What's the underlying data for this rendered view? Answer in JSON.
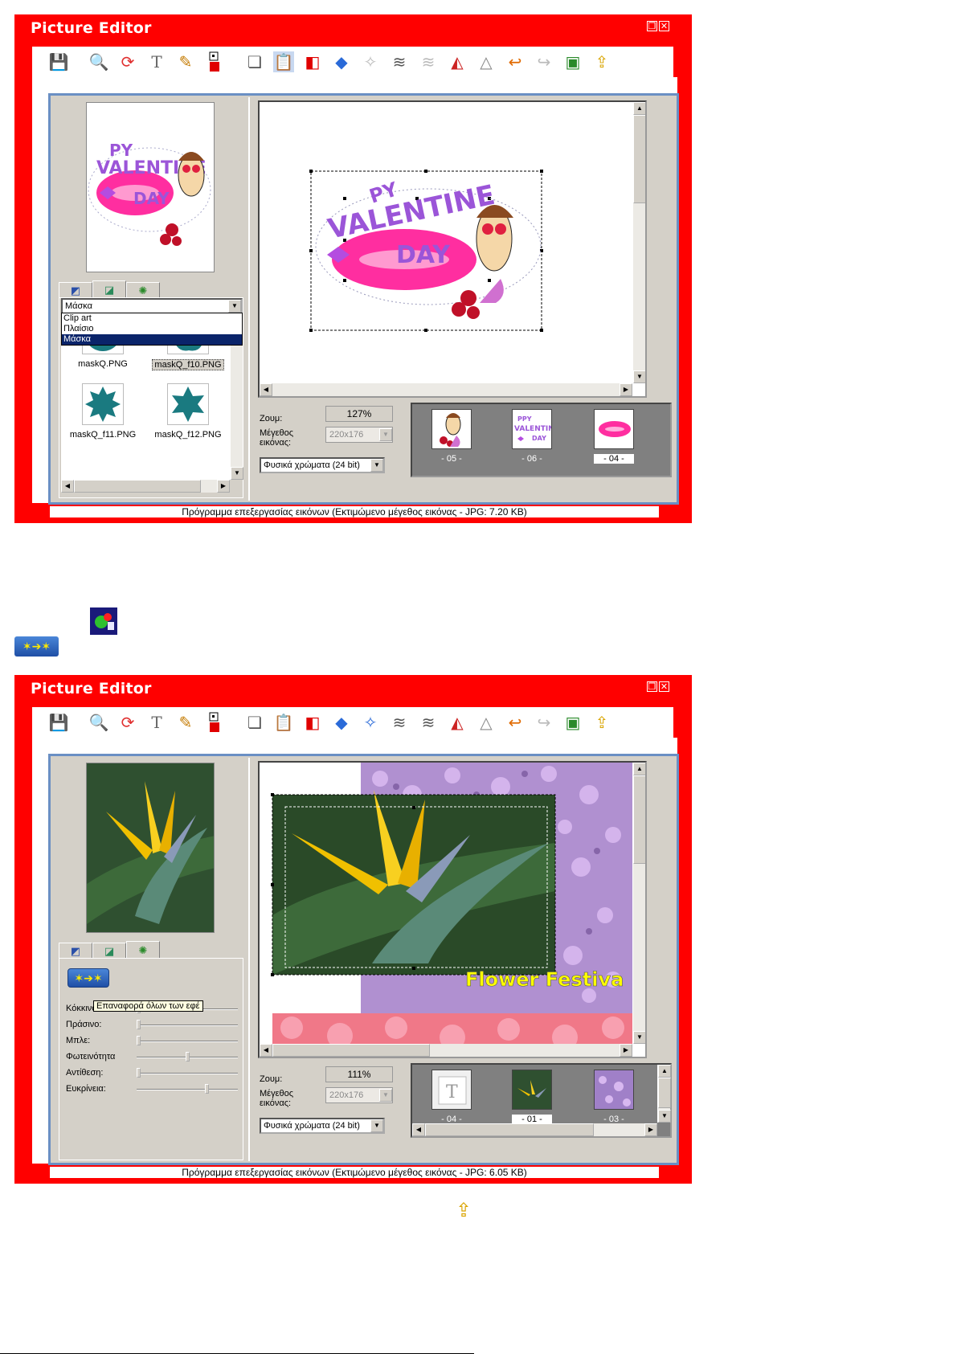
{
  "window1": {
    "title": "Picture Editor",
    "combo_value": "Μάσκα",
    "dropdown_options": [
      "Clip art",
      "Πλαίσιο",
      "Μάσκα"
    ],
    "masks": [
      "maskQ.PNG",
      "maskQ_f10.PNG",
      "maskQ_f11.PNG",
      "maskQ_f12.PNG"
    ],
    "zoom_label": "Ζουμ:",
    "zoom_value": "127%",
    "size_label_1": "Μέγεθος",
    "size_label_2": "εικόνας:",
    "size_value": "220x176",
    "color_mode": "Φυσικά χρώματα (24 bit)",
    "strip": [
      "- 05 -",
      "- 06 -",
      "- 04 -"
    ],
    "clip_text_1": "PY",
    "clip_text_2": "VALENTINE",
    "clip_text_3": "DAY",
    "strip_text_1": "PPY",
    "strip_text_2": "VALENTINE",
    "strip_text_3": "DAY",
    "status": "Πρόγραμμα επεξεργασίας εικόνων  (Εκτιμώμενο μέγεθος εικόνας - JPG:    7.20 KB)"
  },
  "window2": {
    "title": "Picture Editor",
    "tooltip": "Επαναφορά όλων των εφέ",
    "sliders": [
      {
        "name": "Κόκκινο",
        "value": 0.0
      },
      {
        "name": "Πράσινο:",
        "value": 0.0
      },
      {
        "name": "Μπλε:",
        "value": 0.0
      },
      {
        "name": "Φωτεινότητα",
        "value": 0.5
      },
      {
        "name": "Αντίθεση:",
        "value": 0.0
      },
      {
        "name": "Ευκρίνεια:",
        "value": 0.7
      }
    ],
    "overlay_text": "Flower Festiva",
    "zoom_label": "Ζουμ:",
    "zoom_value": "111%",
    "size_label_1": "Μέγεθος",
    "size_label_2": "εικόνας:",
    "size_value": "220x176",
    "color_mode": "Φυσικά χρώματα (24 bit)",
    "strip": [
      "- 04 -",
      "- 01 -",
      "- 03 -"
    ],
    "status": "Πρόγραμμα επεξεργασίας εικόνων  (Εκτιμώμενο μέγεθος εικόνας - JPG:    6.05 KB)"
  },
  "footer": "",
  "colors": {
    "window_red": "#ff0000",
    "frame_blue": "#6a8fc4",
    "panel_gray": "#d4d0c8",
    "mask_teal": "#1a7a80",
    "selection_navy": "#0a246a"
  },
  "icons": [
    "save-icon",
    "zoom-icon",
    "rotate-icon",
    "text-icon",
    "pencil-icon",
    "color-icon",
    "copy-icon",
    "paste-icon",
    "clipart-icon",
    "fill-icon",
    "effects-icon",
    "layers-icon",
    "layers-down-icon",
    "flip-icon",
    "mirror-icon",
    "undo-icon",
    "redo-icon",
    "insert-image-icon",
    "export-icon"
  ]
}
